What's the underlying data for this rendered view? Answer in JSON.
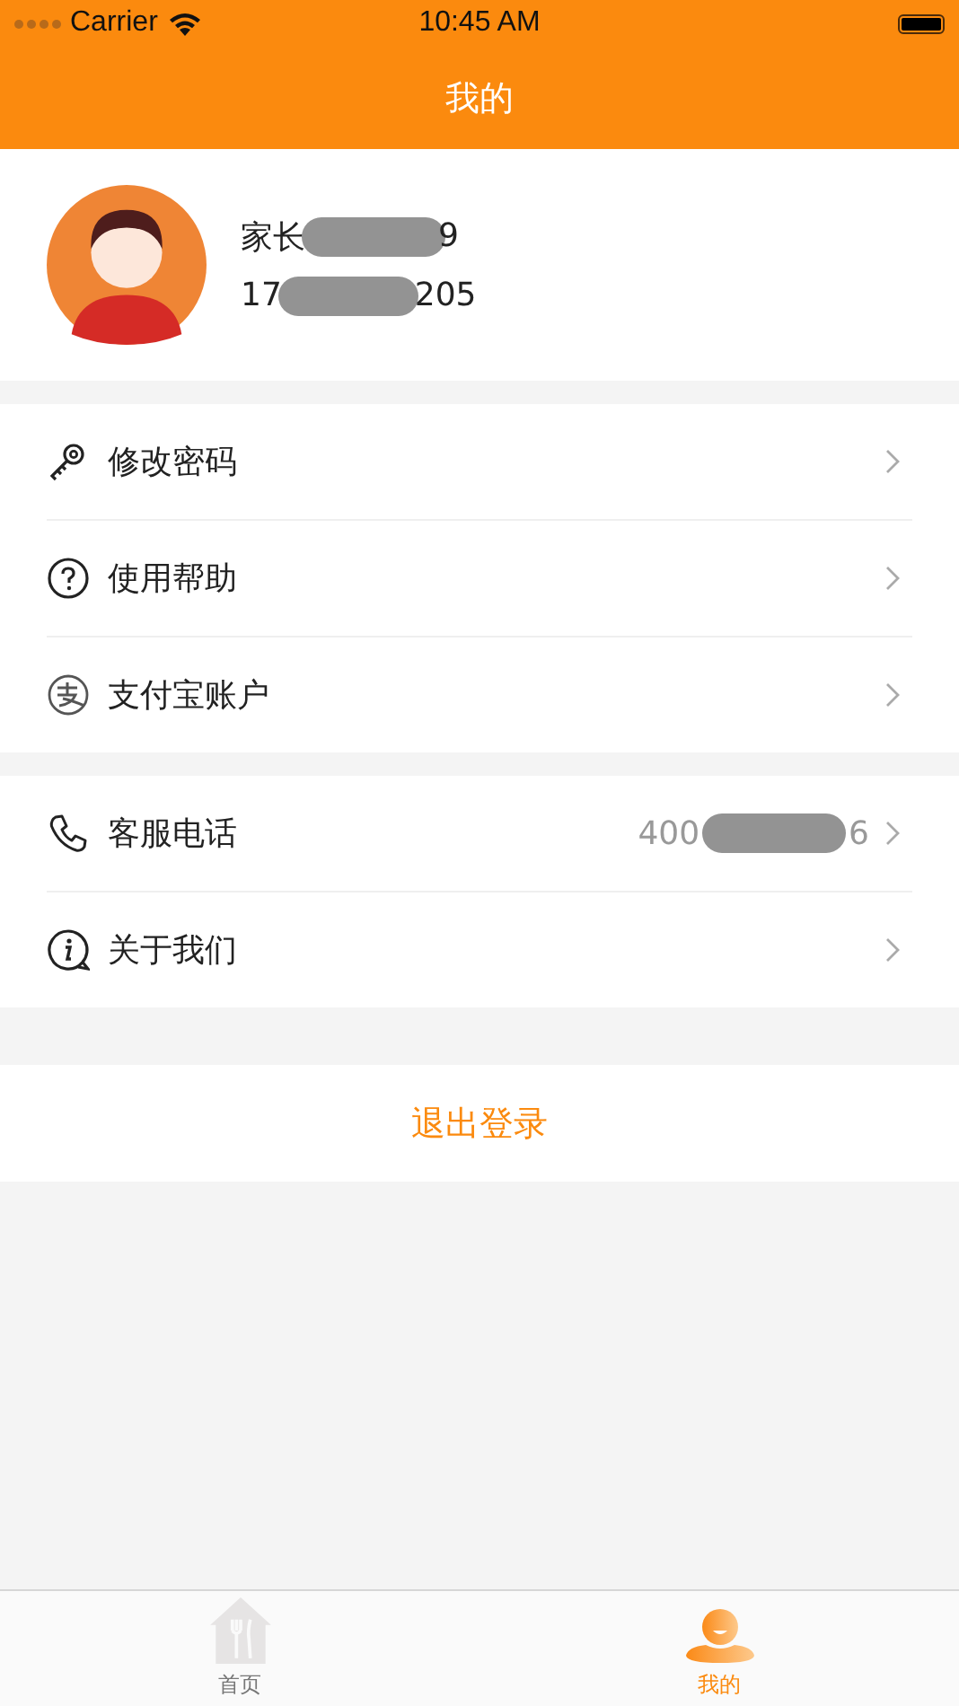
{
  "status_bar": {
    "carrier": "Carrier",
    "time": "10:45 AM"
  },
  "nav_bar": {
    "title": "我的"
  },
  "profile": {
    "name_start": "家长",
    "name_end": "9",
    "phone_start": "17",
    "phone_end": "205"
  },
  "menu_groups": [
    {
      "items": [
        {
          "label": "修改密码"
        },
        {
          "label": "使用帮助"
        },
        {
          "label": "支付宝账户"
        }
      ]
    },
    {
      "items": [
        {
          "label": "客服电话",
          "value_start": "400",
          "value_end": "6"
        },
        {
          "label": "关于我们"
        }
      ]
    }
  ],
  "logout": "退出登录",
  "tab_bar": [
    {
      "label": "首页",
      "selected": false
    },
    {
      "label": "我的",
      "selected": true
    }
  ]
}
